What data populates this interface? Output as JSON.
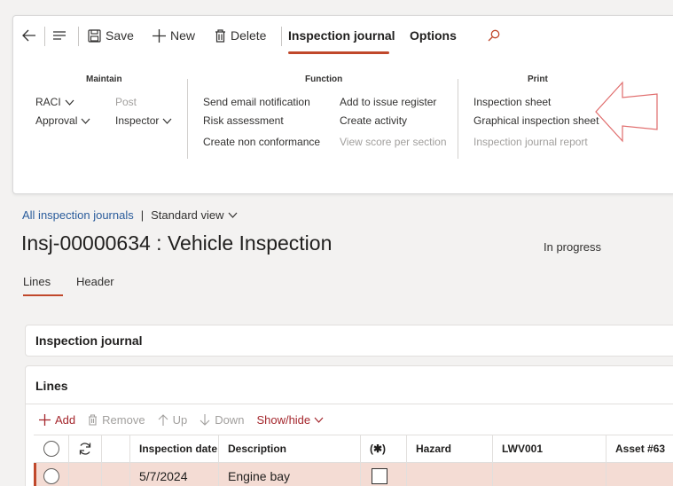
{
  "toolbar": {
    "save_label": "Save",
    "new_label": "New",
    "delete_label": "Delete",
    "tabs": [
      "Inspection journal",
      "Options"
    ]
  },
  "ribbon": {
    "maintain": {
      "title": "Maintain",
      "raci": "RACI",
      "post": "Post",
      "approval": "Approval",
      "inspector": "Inspector"
    },
    "function": {
      "title": "Function",
      "send_email": "Send email notification",
      "add_issue": "Add to issue register",
      "risk": "Risk assessment",
      "create_activity": "Create activity",
      "non_conformance": "Create non conformance",
      "view_score": "View score per section"
    },
    "print": {
      "title": "Print",
      "inspection_sheet": "Inspection sheet",
      "graphical_sheet": "Graphical inspection sheet",
      "journal_report": "Inspection journal report"
    }
  },
  "page": {
    "breadcrumb_link": "All inspection journals",
    "breadcrumb_sep": "|",
    "view": "Standard view",
    "title": "Insj-00000634 : Vehicle Inspection",
    "status": "In progress",
    "subtabs": [
      "Lines",
      "Header"
    ]
  },
  "sections": {
    "journal": "Inspection journal",
    "lines": "Lines"
  },
  "grid_toolbar": {
    "add": "Add",
    "remove": "Remove",
    "up": "Up",
    "down": "Down",
    "showhide": "Show/hide"
  },
  "grid": {
    "columns": [
      "Inspection date",
      "Description",
      "(✱)",
      "Hazard",
      "LWV001",
      "Asset #63"
    ],
    "rows": [
      {
        "date": "5/7/2024",
        "description": "Engine bay"
      }
    ]
  },
  "colors": {
    "accent": "#c0482b",
    "link": "#2b5d9c",
    "selected_row": "#f4dcd4"
  }
}
